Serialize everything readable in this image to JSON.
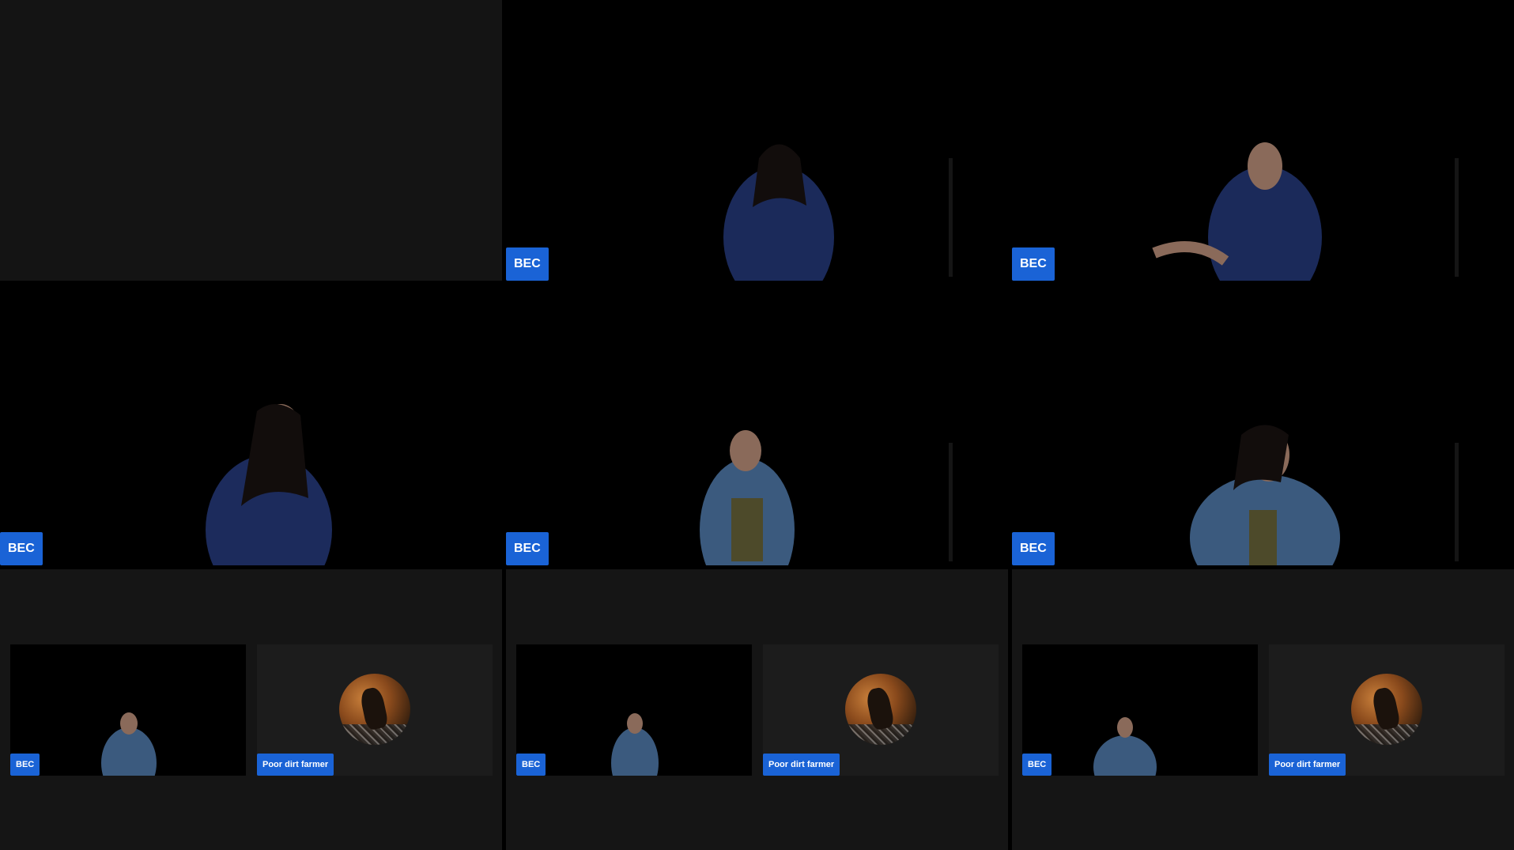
{
  "tiles": {
    "top_left": {},
    "top_middle": {
      "name": "BEC"
    },
    "top_right": {
      "name": "BEC"
    },
    "mid_left": {
      "name": "BEC"
    },
    "mid_middle": {
      "name": "BEC"
    },
    "mid_right": {
      "name": "BEC"
    },
    "bottom_left": {
      "video_name": "BEC",
      "audio_name": "Poor dirt farmer"
    },
    "bottom_middle": {
      "video_name": "BEC",
      "audio_name": "Poor dirt farmer"
    },
    "bottom_right": {
      "video_name": "BEC",
      "audio_name": "Poor dirt farmer"
    }
  },
  "colors": {
    "badge_background": "#1a63d6",
    "badge_text": "#ffffff",
    "empty_tile": "#141414",
    "gallery_tile": "#151515"
  },
  "icons": [
    "participant-avatar-icon"
  ]
}
